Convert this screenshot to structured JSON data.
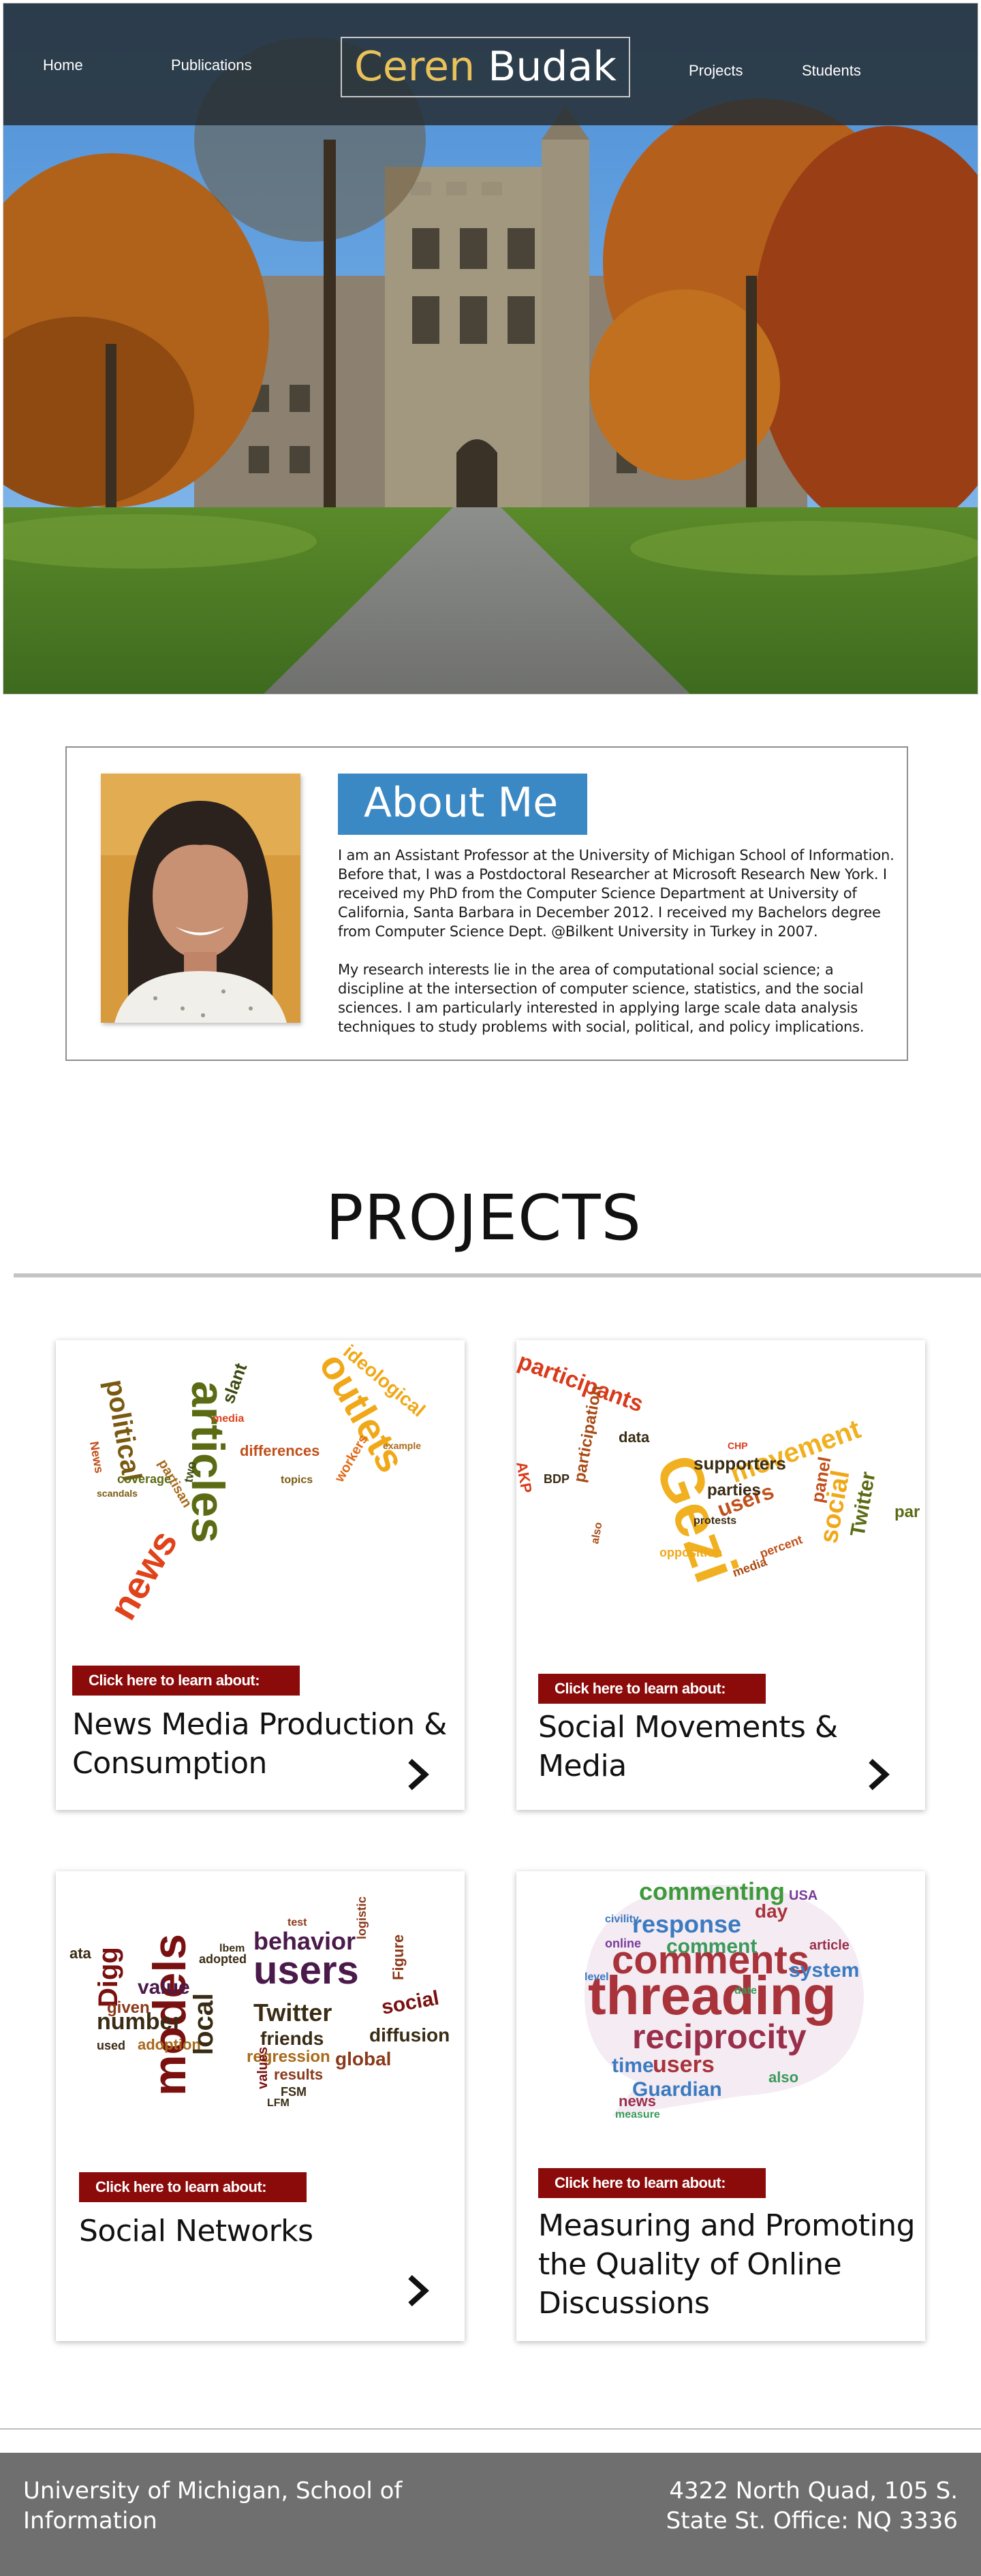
{
  "nav": {
    "home": "Home",
    "publications": "Publications",
    "brand_first": "Ceren",
    "brand_last": "Budak",
    "projects": "Projects",
    "students": "Students"
  },
  "about": {
    "title": "About Me",
    "paragraph1": "I am an Assistant Professor at the University of Michigan School of Information. Before that, I was a Postdoctoral Researcher at Microsoft Research New York. I received my PhD from the Computer Science Department at University of California, Santa Barbara in December 2012. I received my Bachelors degree from Computer Science Dept. @Bilkent University in Turkey in 2007.",
    "paragraph2": "My research interests lie in the area of computational social science; a discipline at the intersection of computer science, statistics, and the social sciences. I am particularly interested in applying large scale data analysis techniques to study problems with social, political, and policy implications."
  },
  "projects": {
    "heading": "PROJECTS",
    "badge_label": "Click here to learn about:",
    "items": [
      {
        "title": "News Media Production & Consumption"
      },
      {
        "title": "Social Movements & Media"
      },
      {
        "title": "Social Networks"
      },
      {
        "title": "Measuring and Promoting the Quality of Online Discussions"
      }
    ]
  },
  "footer": {
    "left": "University of Michigan, School of Information",
    "right": "4322 North Quad, 105 S. State St. Office: NQ 3336"
  }
}
